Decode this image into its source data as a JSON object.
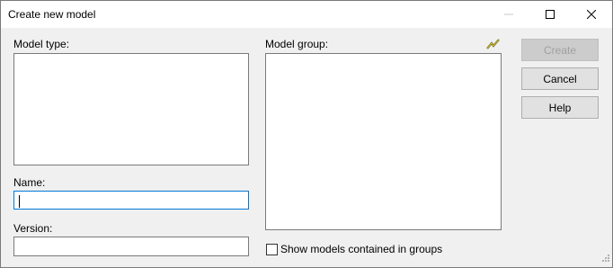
{
  "window": {
    "title": "Create new model"
  },
  "form": {
    "model_type_label": "Model type:",
    "model_group_label": "Model group:",
    "name_label": "Name:",
    "name_value": "",
    "version_label": "Version:",
    "version_value": "",
    "show_groups_label": "Show models contained in groups",
    "show_groups_checked": false
  },
  "buttons": {
    "create": "Create",
    "cancel": "Cancel",
    "help": "Help"
  },
  "colors": {
    "focus_border": "#0078d7",
    "lightning_icon": "#d4b800"
  }
}
